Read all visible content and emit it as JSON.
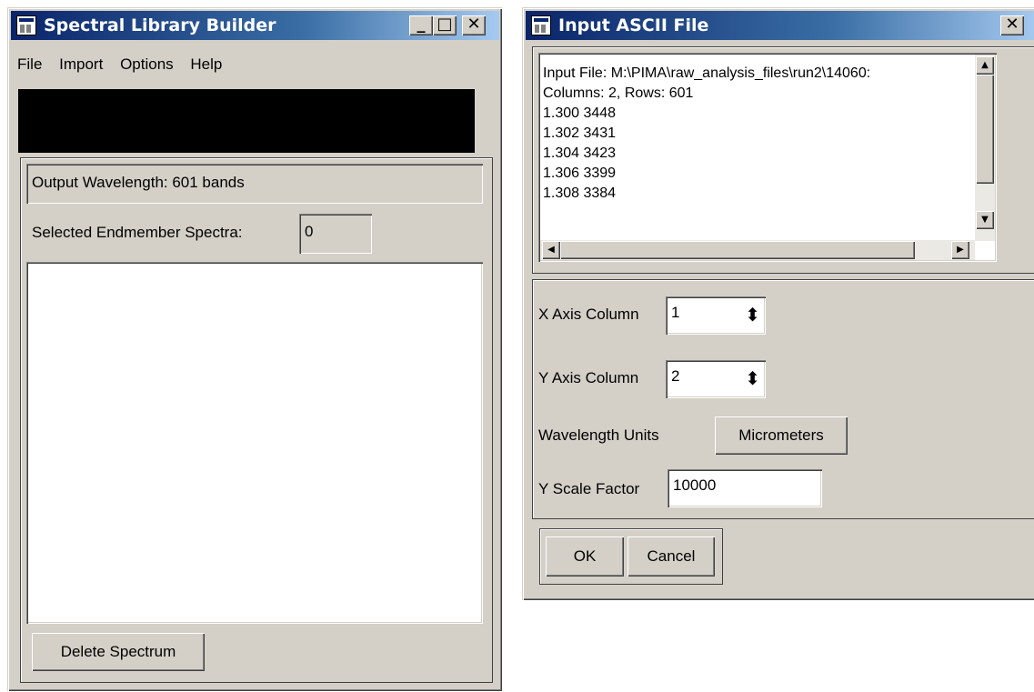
{
  "left_window": {
    "title": "Spectral Library Builder",
    "controls": {
      "minimize": "_",
      "maximize": "□",
      "close": "✕"
    },
    "menu": [
      "File",
      "Import",
      "Options",
      "Help"
    ],
    "output_wavelength": "Output Wavelength: 601 bands",
    "selected_label": "Selected Endmember Spectra:",
    "selected_value": "0",
    "delete_button": "Delete Spectrum"
  },
  "right_window": {
    "title": "Input ASCII File",
    "close": "✕",
    "file_text": {
      "lines": [
        "Input File: M:\\PIMA\\raw_analysis_files\\run2\\14060:",
        "Columns: 2, Rows: 601",
        "1.300 3448",
        "1.302 3431",
        "1.304 3423",
        "1.306 3399",
        "1.308 3384"
      ]
    },
    "x_axis": {
      "label": "X Axis Column",
      "value": "1"
    },
    "y_axis": {
      "label": "Y Axis Column",
      "value": "2"
    },
    "wavelength_units": {
      "label": "Wavelength Units",
      "value": "Micrometers"
    },
    "y_scale": {
      "label": "Y Scale Factor",
      "value": "10000"
    },
    "ok_button": "OK",
    "cancel_button": "Cancel"
  },
  "icons": {
    "scroll_up": "▲",
    "scroll_down": "▼",
    "scroll_left": "◀",
    "scroll_right": "▶",
    "spinner": "⬍"
  },
  "colors": {
    "titlebar_start": "#0a246a",
    "titlebar_end": "#a6caf0",
    "face": "#d4d0c8"
  }
}
